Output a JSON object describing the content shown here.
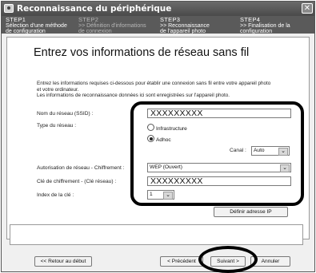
{
  "window": {
    "title": "Reconnaissance du périphérique",
    "close_glyph": "✕"
  },
  "steps": [
    {
      "num": "STEP1",
      "line1": "Sélection d'une méthode",
      "line2": "de configuration"
    },
    {
      "num": "STEP2",
      "line1": ">> Définition d'informations",
      "line2": "de connexion"
    },
    {
      "num": "STEP3",
      "line1": ">> Reconnaissance",
      "line2": "de l'appareil photo"
    },
    {
      "num": "STEP4",
      "line1": ">> Finalisation de la",
      "line2": "configuration"
    }
  ],
  "heading": "Entrez vos informations de réseau sans fil",
  "intro": {
    "line1": "Entrez les informations requises ci-dessous pour établir une connexion sans fil entre votre appareil photo",
    "line2": "et votre ordinateur.",
    "line3": "Les informations de reconnaissance données ici sont enregistrées sur l'appareil photo."
  },
  "form": {
    "ssid_label": "Nom du réseau (SSID) :",
    "ssid_value": "XXXXXXXXX",
    "network_type_label": "Type du réseau :",
    "infrastructure_label": "Infrastructure",
    "adhoc_label": "Adhoc",
    "adhoc_selected": true,
    "channel_label": "Canal :",
    "channel_value": "Auto",
    "auth_label": "Autorisation de réseau - Chiffrement :",
    "auth_value": "WEP (Ouvert)",
    "key_label": "Clé de chiffrement - (Clé réseau) :",
    "key_value": "XXXXXXXXX",
    "key_index_label": "Index de la clé :",
    "key_index_value": "1",
    "ip_button": "Définir adresse IP"
  },
  "footer": {
    "back_to_start": "<< Retour au début",
    "previous": "< Précédent",
    "next": "Suivant >",
    "cancel": "Annuler"
  },
  "icons": {
    "dropdown": "chevron-down-icon",
    "close": "close-icon"
  }
}
